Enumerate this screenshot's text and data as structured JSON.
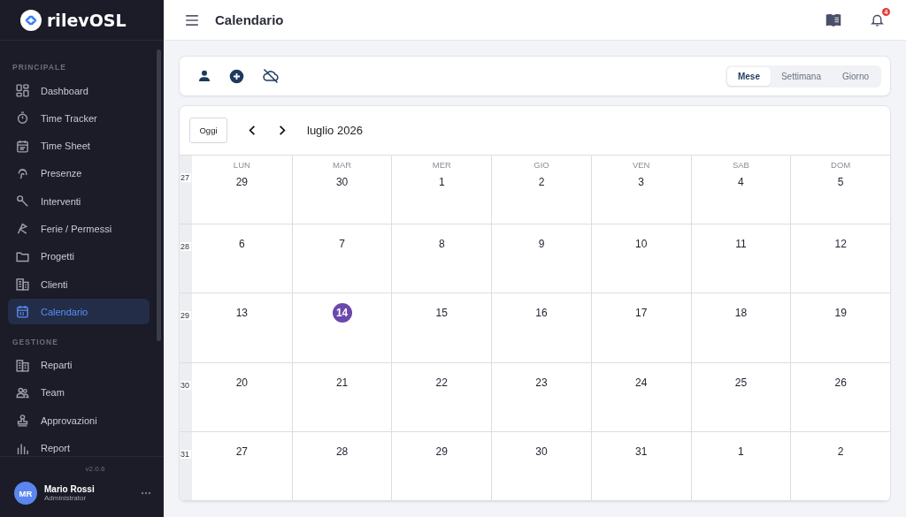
{
  "brand": "rilevOSL",
  "sidebar": {
    "sections": [
      {
        "title": "PRINCIPALE",
        "items": [
          {
            "label": "Dashboard",
            "selected": false
          },
          {
            "label": "Time Tracker",
            "selected": false
          },
          {
            "label": "Time Sheet",
            "selected": false
          },
          {
            "label": "Presenze",
            "selected": false
          },
          {
            "label": "Interventi",
            "selected": false
          },
          {
            "label": "Ferie / Permessi",
            "selected": false
          },
          {
            "label": "Progetti",
            "selected": false
          },
          {
            "label": "Clienti",
            "selected": false
          },
          {
            "label": "Calendario",
            "selected": true
          }
        ]
      },
      {
        "title": "GESTIONE",
        "items": [
          {
            "label": "Reparti",
            "selected": false
          },
          {
            "label": "Team",
            "selected": false
          },
          {
            "label": "Approvazioni",
            "selected": false
          },
          {
            "label": "Report",
            "selected": false
          }
        ]
      }
    ],
    "version": "v2.0.6",
    "user": {
      "initials": "MR",
      "name": "Mario Rossi",
      "role": "Administrator"
    }
  },
  "header": {
    "title": "Calendario",
    "notifications": "4"
  },
  "views": [
    {
      "label": "Mese",
      "selected": true
    },
    {
      "label": "Settimana",
      "selected": false
    },
    {
      "label": "Giorno",
      "selected": false
    }
  ],
  "calendar": {
    "today_button": "Oggi",
    "month": "luglio 2026",
    "weekdays": [
      "LUN",
      "MAR",
      "MER",
      "GIO",
      "VEN",
      "SAB",
      "DOM"
    ],
    "weeks": [
      {
        "number": "27",
        "days": [
          {
            "label": "29",
            "today": false
          },
          {
            "label": "30",
            "today": false
          },
          {
            "label": "1",
            "today": false
          },
          {
            "label": "2",
            "today": false
          },
          {
            "label": "3",
            "today": false
          },
          {
            "label": "4",
            "today": false
          },
          {
            "label": "5",
            "today": false
          }
        ]
      },
      {
        "number": "28",
        "days": [
          {
            "label": "6",
            "today": false
          },
          {
            "label": "7",
            "today": false
          },
          {
            "label": "8",
            "today": false
          },
          {
            "label": "9",
            "today": false
          },
          {
            "label": "10",
            "today": false
          },
          {
            "label": "11",
            "today": false
          },
          {
            "label": "12",
            "today": false
          }
        ]
      },
      {
        "number": "29",
        "days": [
          {
            "label": "13",
            "today": false
          },
          {
            "label": "14",
            "today": true
          },
          {
            "label": "15",
            "today": false
          },
          {
            "label": "16",
            "today": false
          },
          {
            "label": "17",
            "today": false
          },
          {
            "label": "18",
            "today": false
          },
          {
            "label": "19",
            "today": false
          }
        ]
      },
      {
        "number": "30",
        "days": [
          {
            "label": "20",
            "today": false
          },
          {
            "label": "21",
            "today": false
          },
          {
            "label": "22",
            "today": false
          },
          {
            "label": "23",
            "today": false
          },
          {
            "label": "24",
            "today": false
          },
          {
            "label": "25",
            "today": false
          },
          {
            "label": "26",
            "today": false
          }
        ]
      },
      {
        "number": "31",
        "days": [
          {
            "label": "27",
            "today": false
          },
          {
            "label": "28",
            "today": false
          },
          {
            "label": "29",
            "today": false
          },
          {
            "label": "30",
            "today": false
          },
          {
            "label": "31",
            "today": false
          },
          {
            "label": "1",
            "today": false
          },
          {
            "label": "2",
            "today": false
          }
        ]
      }
    ]
  }
}
